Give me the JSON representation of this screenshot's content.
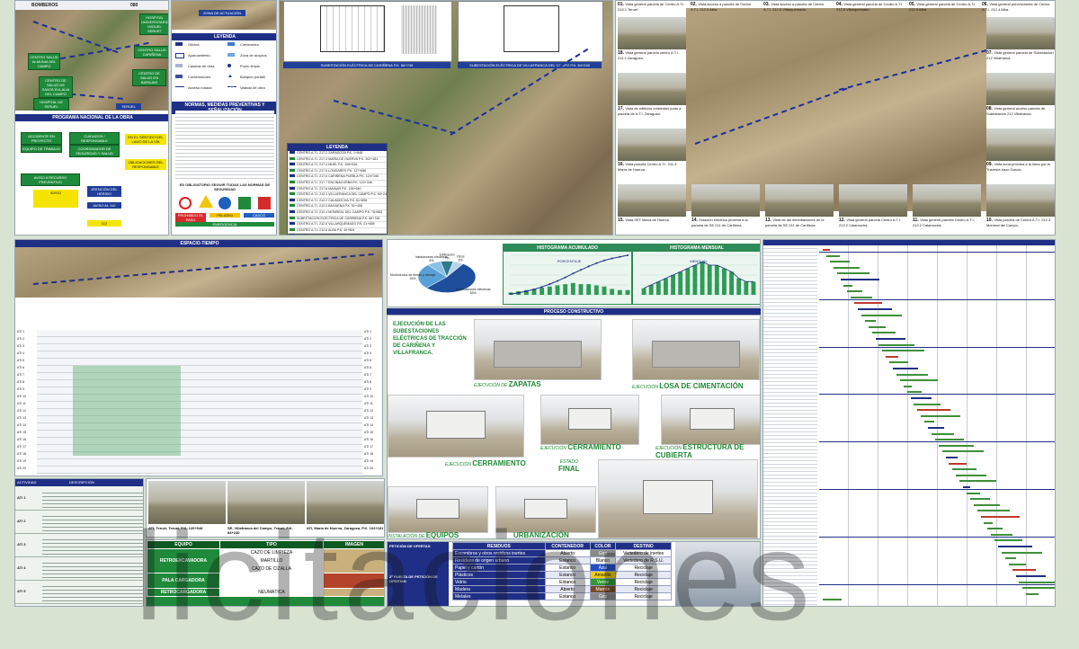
{
  "colors": {
    "navy": "#1f2f86",
    "green": "#1e8a3a",
    "yellow": "#f5e400"
  },
  "topleft": {
    "row_label": "BOMBEROS",
    "row_value": "080",
    "map_boxes": [
      "HOSPITAL UNIVERSITARIO MIGUEL SERVET",
      "CENTRO SALUD CARIÑENA",
      "CENTRO SALUD ALMUNIA DEL CAMPO",
      "CENTRO DE SALUD DE SANTA EULALIA DEL CAMPO",
      "CENTRO DE SALUD EN BARAJAS",
      "HOSPITAL DE TERUEL",
      "TERUEL"
    ],
    "program_title": "PROGRAMA NACIONAL DE LA OBRA",
    "flow": [
      "ACCIDENTE EN PROYECTO",
      "EQUIPO DE TRABAJO",
      "CUIDADOS / RESPONSABLE",
      "COORDINADOR DE SEGURIDAD Y SALUD",
      "AVISO A RECURSO PREVENTIVO",
      "ATENCIÓN DEL HERIDO",
      "AVISO AL 112",
      "112"
    ],
    "notes": [
      "EN EL SENTIDO DEL LADO DE LA VÍA",
      "OBLIGACIONES DEL RESPONSABLE",
      "AVISO"
    ]
  },
  "legend_panel": {
    "header": "LEYENDA",
    "items": [
      "Oficina",
      "Contenedor",
      "Aparcamiento",
      "Zona de acopios",
      "Casetas de obra",
      "Punto limpio",
      "Contenedores",
      "Botiquín portátil",
      "Acceso rodado",
      "Vallado de obra"
    ],
    "zone_label": "ZONA DE ACTUACIÓN",
    "norms_header": "NORMAS, MEDIDAS PREVENTIVAS Y SEÑALIZACIÓN",
    "signs_header": "ES OBLIGATORIO SEGUIR TODAS LAS NORMAS DE SEGURIDAD",
    "signs": [
      "PROHIBIDO EL PASO",
      "PELIGRO",
      "CASCO",
      "EMERGENCIA"
    ]
  },
  "route_panel": {
    "header": "LEYENDA",
    "list": [
      "CENTRO A.T.I. 217.2 ZARAGOZA P.K. 1+648",
      "CENTRO A.T.I. 217.3 MARÍA DE HUERVA P.K. 102+181",
      "CENTRO A.T.I. 217.4 MUEL P.K. 108+516",
      "CENTRO A.T.I. 217.5 LONGARES P.K. 117+066",
      "CENTRO A.T.I. 217.6 CARIÑENA PUEBLA P.K. 124+346",
      "CENTRO A.T.I. 217.7 ENCINACORBA P.K. 124+346",
      "CENTRO A.T.I. 217.8 MAINAR P.K. 136+640",
      "CENTRO A.T.I. 212.1 VILLAFRANCA DEL CAMPO P.K. 84+240",
      "CENTRO A.T.I. 212.2 CALAMOCHA P.K. 61+898",
      "CENTRO A.T.I. 212.3 BAGUENA P.K. 51+406",
      "CENTRO A.T.I. 212.4 MONREAL DEL CAMPO P.K. 78+669",
      "SUBESTACIÓN ELÉCTRICA DE CARIÑENA P.K. 66+745",
      "CENTRO A.T.I. 212.5 VILLARQUEMADO P.K. 21+658",
      "CENTRO A.T.I. 212.6 ALBA P.K. 40+604",
      "CENTRO A.T.I. 212.7 TERUEL P.K. 120+548"
    ],
    "plan_captions": [
      "SUBESTACIÓN ELÉCTRICA DE CARIÑENA P.K. 66+745",
      "SUBESTACIÓN ELÉCTRICA DE VILLAFRANCA DEL CAMPO P.K. 84+240"
    ]
  },
  "photos": [
    {
      "n": "01.",
      "t": "Vista general parcela de Centro A.T.I. 215.1 Teruel."
    },
    {
      "n": "02.",
      "t": "Vista acceso a parcela de Centro A.T.I. 212.6 Alba."
    },
    {
      "n": "03.",
      "t": "Vista acceso a parcela de Centro A.T.I. 212.5 Villarquemado."
    },
    {
      "n": "04.",
      "t": "Vista general parcela de Centro A.T.I. 212.5 Villarquemado."
    },
    {
      "n": "05.",
      "t": "Vista general parcela de Centro A.T.I. 212.4 Alba."
    },
    {
      "n": "06.",
      "t": "Vista general prevenciones de Centro A.T.I. 212.4 Alba."
    },
    {
      "n": "07.",
      "t": "Vista general parcela de Subestación 212 Villafranca."
    },
    {
      "n": "08.",
      "t": "Vista general acceso parcela de Subestación 212 Villafranca."
    },
    {
      "n": "09.",
      "t": "Vista zona próxima a la línea por la Travesía Irazo García."
    },
    {
      "n": "10.",
      "t": "Vista parcela de Centro A.T.I. 212.3 Monreal del Campo."
    },
    {
      "n": "11.",
      "t": "Vista general parcela Centro A.T.I. 212.2 Calamocha."
    },
    {
      "n": "12.",
      "t": "Vista general parcela Centro A.T.I. 212.2 Calamocha."
    },
    {
      "n": "13.",
      "t": "Vista de las inmediaciones de la parcela de SE 211 de Cariñena."
    },
    {
      "n": "14.",
      "t": "Estación eléctrica próxima a la parcela de SE 211 de Cariñena."
    },
    {
      "n": "15.",
      "t": "Vista SET María de Huerva."
    },
    {
      "n": "16.",
      "t": "Vista parcela Centro A.T.I. 211.3 María de Huerva."
    },
    {
      "n": "17.",
      "t": "Vista de edificios existentes junto a parcela de A.T.I. Zaragoza."
    },
    {
      "n": "18.",
      "t": "Vista general parcela centro A.T.I. 211.2 Zaragoza."
    }
  ],
  "gantt": {
    "header": "ESPACIO-TIEMPO",
    "rows": [
      "ATI 1",
      "ATI 2",
      "ATI 3",
      "ATI 4",
      "ATI 5",
      "ATI 6",
      "ATI 7",
      "ATI 8",
      "ATI 9",
      "ATI 10",
      "ATI 11",
      "ATI 12",
      "ATI 13",
      "ATI 14",
      "ATI 15",
      "ATI 16",
      "ATI 17",
      "ATI 18",
      "ATI 19",
      "ATI 20"
    ]
  },
  "chart_data": [
    {
      "type": "pie",
      "title": "",
      "labels": [
        "Subestaciones eléctricas",
        "Movimientos de tierras y drenaje",
        "Instalaciones eléctricas",
        "Edificación",
        "Otros"
      ],
      "values": [
        53,
        26,
        8,
        7,
        6
      ],
      "colors": [
        "#1f4e9c",
        "#5aa0d8",
        "#8bbfe3",
        "#2d7a8f",
        "#b9d3e8"
      ]
    },
    {
      "type": "line",
      "title": "HISTOGRAMA ACUMULADO",
      "series": [
        {
          "name": "PORCENTAJE",
          "values": [
            2,
            5,
            9,
            14,
            20,
            27,
            35,
            44,
            54,
            63,
            72,
            80,
            87,
            92,
            96,
            100
          ]
        }
      ]
    },
    {
      "type": "bar",
      "title": "HISTOGRAMA MENSUAL",
      "series": [
        {
          "name": "MENSUAL",
          "values": [
            2,
            3,
            4,
            5,
            6,
            7,
            8,
            9,
            10,
            9,
            9,
            8,
            7,
            5,
            4,
            4
          ]
        }
      ]
    }
  ],
  "chart_footer": "PROCESO CONSTRUCTIVO",
  "construction": {
    "title": "EJECUCIÓN DE LAS SUBESTACIONES ELÉCTRICAS DE TRACCIÓN DE CARIÑENA Y VILLAFRANCA.",
    "stages": [
      {
        "pre": "EJECUCIÓN DE",
        "name": "ZAPATAS"
      },
      {
        "pre": "EJECUCIÓN",
        "name": "LOSA DE CIMENTACIÓN"
      },
      {
        "pre": "EJECUCIÓN",
        "name": "CERRAMIENTO"
      },
      {
        "pre": "EJECUCIÓN",
        "name": "ESTRUCTURA DE CUBIERTA"
      },
      {
        "pre": "EJECUCIÓN",
        "name": "CERRAMIENTO"
      },
      {
        "pre": "ESTADO",
        "name": "FINAL"
      },
      {
        "pre": "INSTALACIÓN DE",
        "name": "EQUIPOS"
      },
      {
        "pre": "",
        "name": "URBANIZACIÓN"
      }
    ]
  },
  "activities": {
    "headers": [
      "ACTIVIDAD",
      "DESCRIPCIÓN"
    ],
    "rows": [
      "ATI 1",
      "ATI 2",
      "ATI 3",
      "ATI 4",
      "ATI 5"
    ]
  },
  "site_photos": [
    {
      "t": "ATI, Teruel, Teruel, P.K. 120+548"
    },
    {
      "t": "SE, Villafranca del Campo, Teruel, P.K. 84+240"
    },
    {
      "t": "ATI, María de Huerva, Zaragoza, P.K. 102+181"
    }
  ],
  "equipment": {
    "headers": [
      "EQUIPO",
      "TIPO",
      "IMAGEN"
    ],
    "rows": [
      {
        "equipo": "RETROEXCAVADORA",
        "tipos": [
          "CAZO DE LIMPIEZA",
          "MARTILLO",
          "CAZO DE CIZALLA"
        ]
      },
      {
        "equipo": "PALA CARGADORA",
        "tipos": [
          ""
        ]
      },
      {
        "equipo": "RETROCARGADORA",
        "tipos": [
          "NEUMÁTICA"
        ]
      }
    ]
  },
  "waste": {
    "headers": [
      "RESIDUOS",
      "CONTENEDOR",
      "COLOR",
      "DESTINO"
    ],
    "rows": [
      [
        "Escombros y otros residuos inertes",
        "Abierto",
        "Gris",
        "Vertedero de inertes"
      ],
      [
        "Residuos de origen urbano",
        "Estanco",
        "Blanco",
        "Vertedero de R.S.U."
      ],
      [
        "Papel y cartón",
        "Estanco",
        "Azul",
        "Reciclaje"
      ],
      [
        "Plásticos",
        "Estanco",
        "Amarillo",
        "Reciclaje"
      ],
      [
        "Vidrio",
        "Estanco",
        "Verde",
        "Reciclaje"
      ],
      [
        "Madera",
        "Abierto",
        "Marrón",
        "Reciclaje"
      ],
      [
        "Metales",
        "Estanco",
        "Gris",
        "Reciclaje"
      ]
    ],
    "cell_colors": [
      "#8a8a8a",
      "#ffffff",
      "#1f4fc9",
      "#f2d100",
      "#2e9b2e",
      "#7a4b21",
      "#8a8a8a"
    ],
    "side_title": "PETICIÓN DE OFERTAS",
    "side_title2": "2ª RUELTA DE PETICIÓN DE OFERTAS"
  },
  "watermark": "licitaciones"
}
